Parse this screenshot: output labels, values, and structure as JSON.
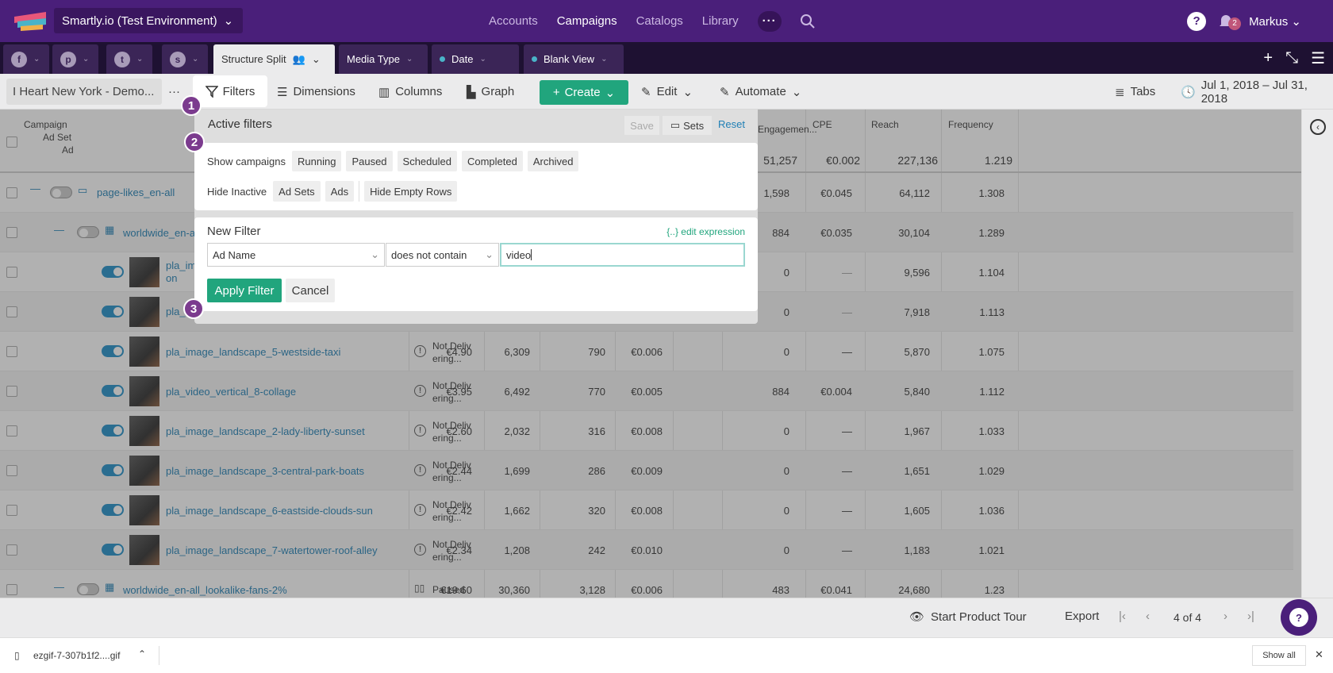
{
  "topbar": {
    "account": "Smartly.io (Test Environment)",
    "nav": [
      "Accounts",
      "Campaigns",
      "Catalogs",
      "Library"
    ],
    "active_nav": "Campaigns",
    "notifications": "2",
    "user": "Markus"
  },
  "tabs": [
    {
      "label": "Structure Split"
    },
    {
      "label": "Media Type"
    },
    {
      "label": "Date"
    },
    {
      "label": "Blank View"
    }
  ],
  "toolbar": {
    "view": "I Heart New York - Demo...",
    "filters": "Filters",
    "dimensions": "Dimensions",
    "columns": "Columns",
    "graph": "Graph",
    "create": "Create",
    "edit": "Edit",
    "automate": "Automate",
    "tabs": "Tabs",
    "date_range": "Jul 1, 2018 – Jul 31, 2018"
  },
  "table": {
    "header": {
      "level1": "Campaign",
      "level2": "Ad Set",
      "level3": "Ad",
      "engagement": "Engagemen...",
      "cpe": "CPE",
      "reach": "Reach",
      "frequency": "Frequency",
      "totals": {
        "engagement": "51,257",
        "cpe": "€0.002",
        "reach": "227,136",
        "frequency": "1.219"
      }
    },
    "rows": [
      {
        "name": "page-likes_en-all",
        "type": "campaign",
        "engagement": "1,598",
        "cpe": "€0.045",
        "reach": "64,112",
        "frequency": "1.308"
      },
      {
        "name": "worldwide_en-a",
        "type": "adset",
        "engagement": "884",
        "cpe": "€0.035",
        "reach": "30,104",
        "frequency": "1.289"
      },
      {
        "name": "pla_im",
        "name2": "on",
        "type": "ad",
        "engagement": "0",
        "cpe": "—",
        "reach": "9,596",
        "frequency": "1.104"
      },
      {
        "name": "pla_",
        "type": "ad",
        "engagement": "0",
        "cpe": "—",
        "reach": "7,918",
        "frequency": "1.113"
      },
      {
        "name": "pla_image_landscape_5-westside-taxi",
        "type": "ad",
        "status1": "Not Deliv",
        "status2": "ering...",
        "spent": "€4.90",
        "impr": "6,309",
        "clicks": "790",
        "cpc": "€0.006",
        "engagement": "0",
        "cpe": "—",
        "reach": "5,870",
        "frequency": "1.075"
      },
      {
        "name": "pla_video_vertical_8-collage",
        "type": "ad",
        "status1": "Not Deliv",
        "status2": "ering...",
        "spent": "€3.95",
        "impr": "6,492",
        "clicks": "770",
        "cpc": "€0.005",
        "engagement": "884",
        "cpe": "€0.004",
        "reach": "5,840",
        "frequency": "1.112"
      },
      {
        "name": "pla_image_landscape_2-lady-liberty-sunset",
        "type": "ad",
        "status1": "Not Deliv",
        "status2": "ering...",
        "spent": "€2.60",
        "impr": "2,032",
        "clicks": "316",
        "cpc": "€0.008",
        "engagement": "0",
        "cpe": "—",
        "reach": "1,967",
        "frequency": "1.033"
      },
      {
        "name": "pla_image_landscape_3-central-park-boats",
        "type": "ad",
        "status1": "Not Deliv",
        "status2": "ering...",
        "spent": "€2.44",
        "impr": "1,699",
        "clicks": "286",
        "cpc": "€0.009",
        "engagement": "0",
        "cpe": "—",
        "reach": "1,651",
        "frequency": "1.029"
      },
      {
        "name": "pla_image_landscape_6-eastside-clouds-sun",
        "type": "ad",
        "status1": "Not Deliv",
        "status2": "ering...",
        "spent": "€2.42",
        "impr": "1,662",
        "clicks": "320",
        "cpc": "€0.008",
        "engagement": "0",
        "cpe": "—",
        "reach": "1,605",
        "frequency": "1.036"
      },
      {
        "name": "pla_image_landscape_7-watertower-roof-alley",
        "type": "ad",
        "status1": "Not Deliv",
        "status2": "ering...",
        "spent": "€2.34",
        "impr": "1,208",
        "clicks": "242",
        "cpc": "€0.010",
        "engagement": "0",
        "cpe": "—",
        "reach": "1,183",
        "frequency": "1.021"
      },
      {
        "name": "worldwide_en-all_lookalike-fans-2%",
        "type": "adset",
        "status1": "Paused",
        "spent": "€19.60",
        "impr": "30,360",
        "clicks": "3,128",
        "cpc": "€0.006",
        "engagement": "483",
        "cpe": "€0.041",
        "reach": "24,680",
        "frequency": "1.23"
      }
    ]
  },
  "filters_popup": {
    "title": "Active filters",
    "save": "Save",
    "sets": "Sets",
    "reset": "Reset",
    "show_campaigns_label": "Show campaigns",
    "show_campaigns": [
      "Running",
      "Paused",
      "Scheduled",
      "Completed",
      "Archived"
    ],
    "hide_inactive_label": "Hide Inactive",
    "hide_inactive": [
      "Ad Sets",
      "Ads"
    ],
    "hide_empty": "Hide Empty Rows",
    "new_filter_title": "New Filter",
    "edit_expression": "{..} edit expression",
    "field": "Ad Name",
    "operator": "does not contain",
    "value": "video",
    "apply": "Apply Filter",
    "cancel": "Cancel",
    "steps": [
      "1",
      "2",
      "3"
    ]
  },
  "bottom": {
    "tour": "Start Product Tour",
    "export": "Export",
    "page": "4 of 4"
  },
  "download": {
    "file": "ezgif-7-307b1f2....gif",
    "show_all": "Show all"
  }
}
